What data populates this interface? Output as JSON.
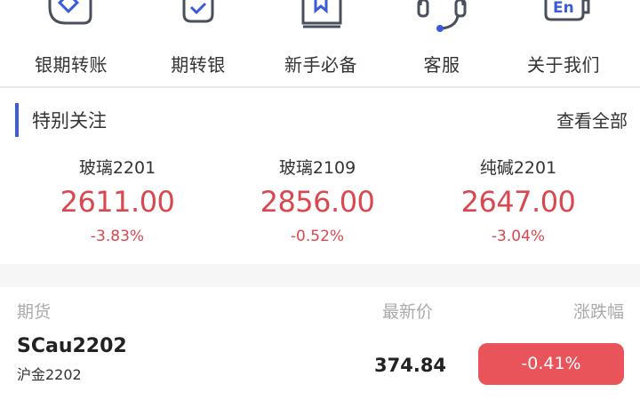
{
  "quick_actions": [
    {
      "label": "银期转账",
      "icon": "bank-futures-transfer-icon"
    },
    {
      "label": "期转银",
      "icon": "futures-to-bank-icon"
    },
    {
      "label": "新手必备",
      "icon": "beginner-guide-book-icon"
    },
    {
      "label": "客服",
      "icon": "customer-service-headset-icon"
    },
    {
      "label": "关于我们",
      "icon": "about-us-en-icon"
    }
  ],
  "special": {
    "title": "特别关注",
    "more": "查看全部",
    "quotes": [
      {
        "name": "玻璃2201",
        "price": "2611.00",
        "change": "-3.83%"
      },
      {
        "name": "玻璃2109",
        "price": "2856.00",
        "change": "-0.52%"
      },
      {
        "name": "纯碱2201",
        "price": "2647.00",
        "change": "-3.04%"
      }
    ]
  },
  "futures_table": {
    "headers": {
      "name": "期货",
      "price": "最新价",
      "change": "涨跌幅"
    },
    "rows": [
      {
        "code": "SCau2202",
        "name": "沪金2202",
        "price": "374.84",
        "change": "-0.41%"
      }
    ]
  },
  "colors": {
    "accent_blue": "#3b5bd9",
    "down_red": "#d9484e",
    "badge_red": "#e8545a",
    "icon_stroke": "#4a4f5c"
  }
}
